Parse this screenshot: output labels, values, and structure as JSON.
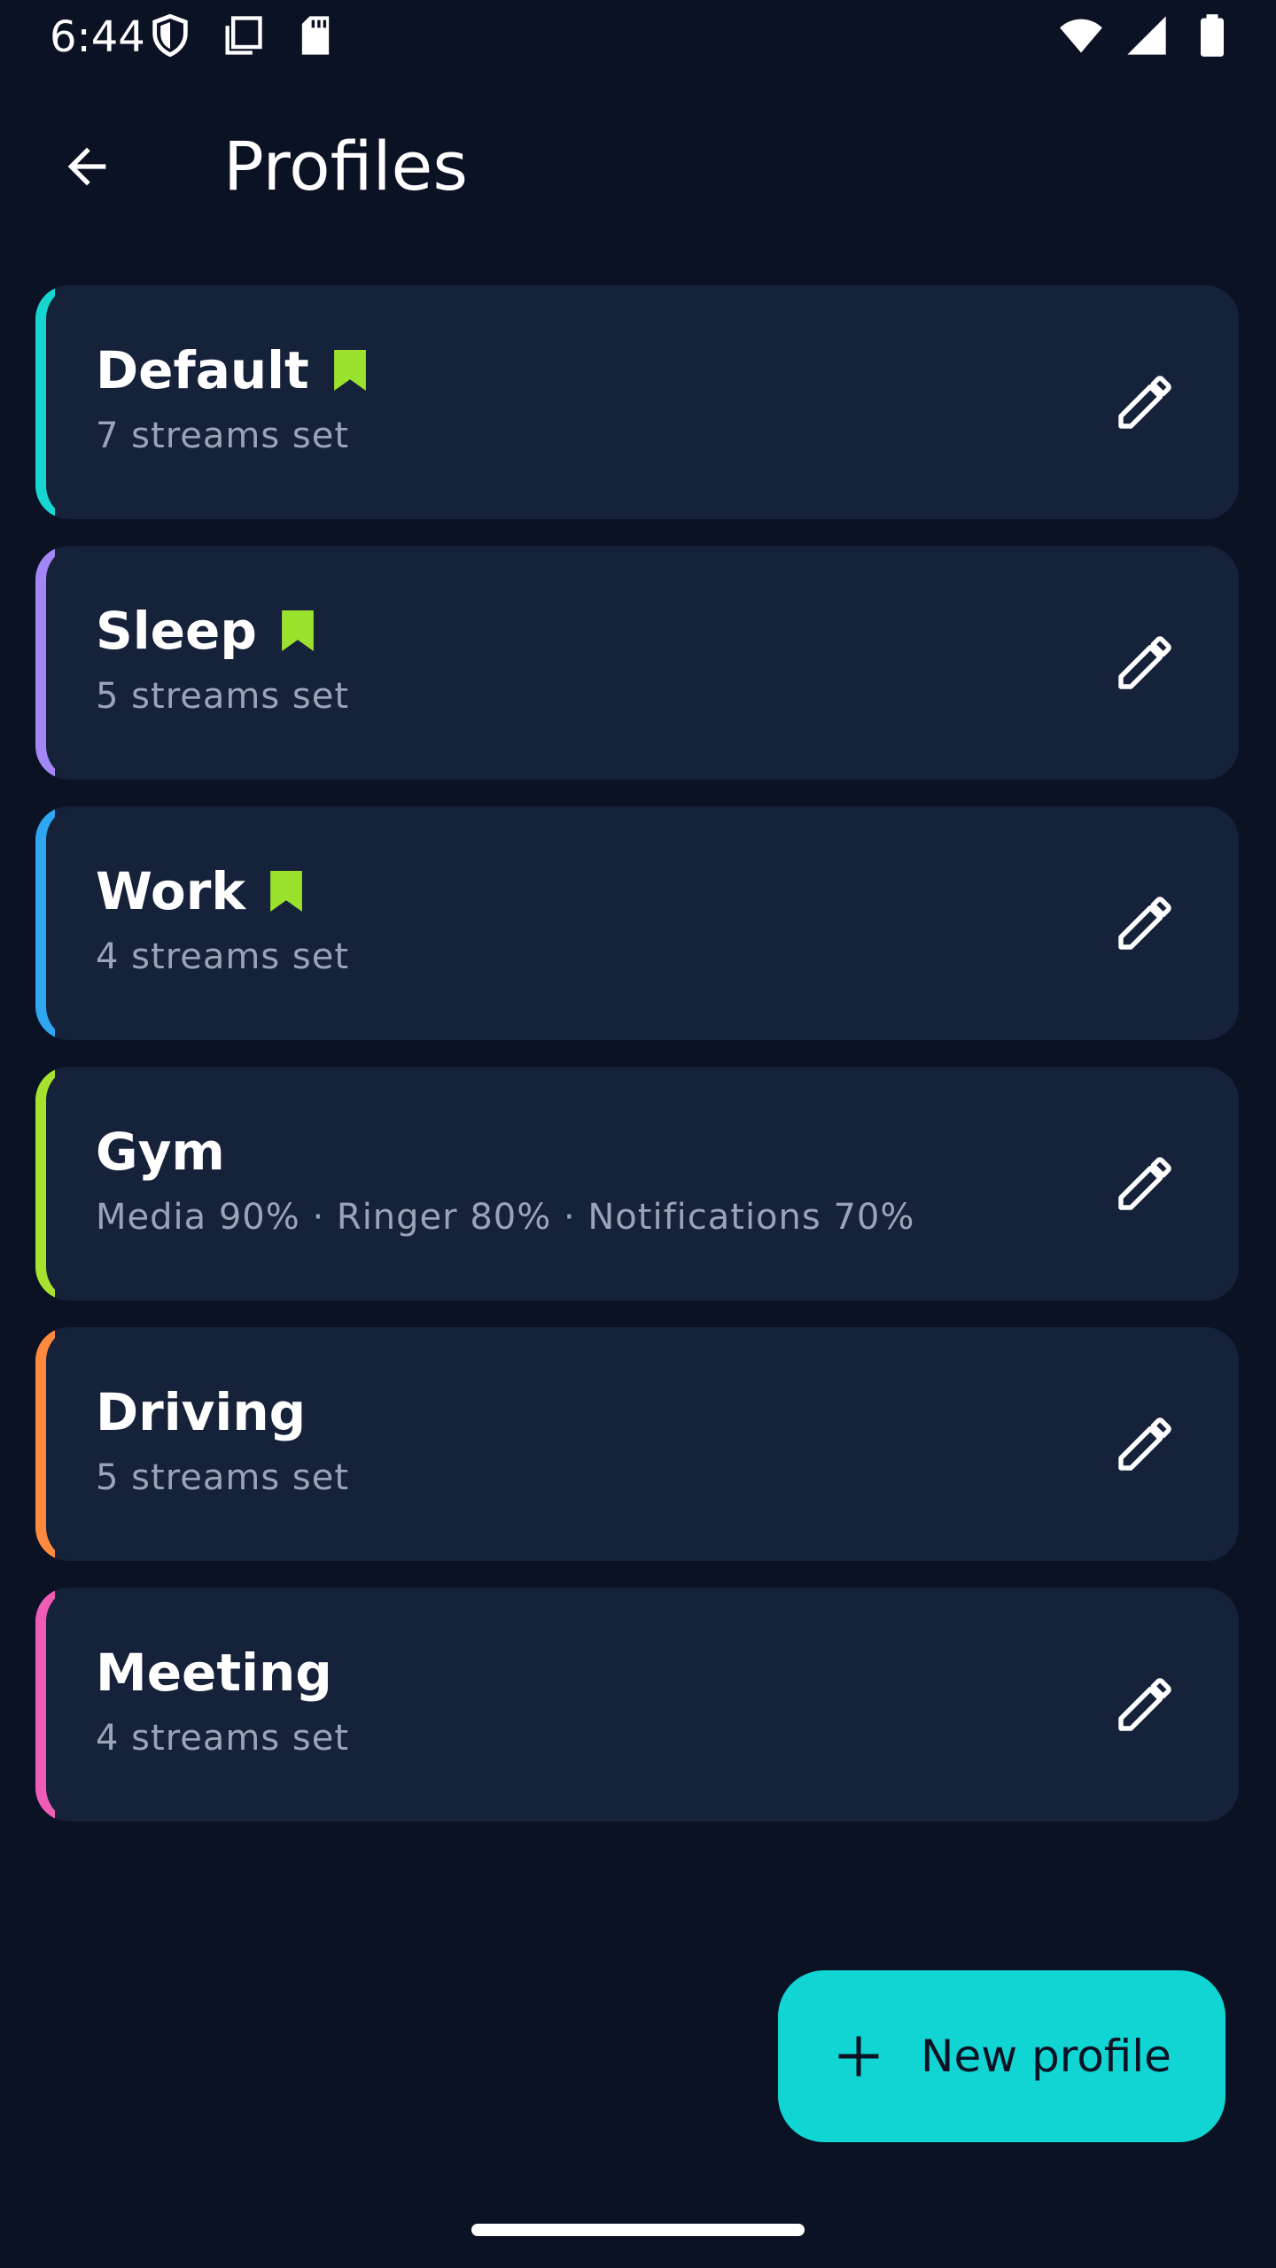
{
  "status_bar": {
    "time": "6:44",
    "left_icons": [
      "shield-icon",
      "copy-icon",
      "sd-card-icon"
    ],
    "right_icons": [
      "wifi-icon",
      "signal-icon",
      "battery-icon"
    ]
  },
  "app_bar": {
    "back_icon": "arrow-back-icon",
    "title": "Profiles"
  },
  "profiles": [
    {
      "name": "Default",
      "summary": "7 streams set",
      "accent": "#16d6cf",
      "pinned": true
    },
    {
      "name": "Sleep",
      "summary": "5 streams set",
      "accent": "#a487f7",
      "pinned": true
    },
    {
      "name": "Work",
      "summary": "4 streams set",
      "accent": "#2ea6f0",
      "pinned": true
    },
    {
      "name": "Gym",
      "summary": "Media 90% · Ringer 80% · Notifications 70%",
      "accent": "#a6e22e",
      "pinned": false
    },
    {
      "name": "Driving",
      "summary": "5 streams set",
      "accent": "#ff8a3d",
      "pinned": false
    },
    {
      "name": "Meeting",
      "summary": "4 streams set",
      "accent": "#f05db6",
      "pinned": false
    }
  ],
  "fab": {
    "icon": "plus-icon",
    "label": "New profile"
  },
  "colors": {
    "background": "#0b1224",
    "card": "#16213a",
    "bookmark": "#9be22e",
    "fab": "#10d5d2"
  }
}
